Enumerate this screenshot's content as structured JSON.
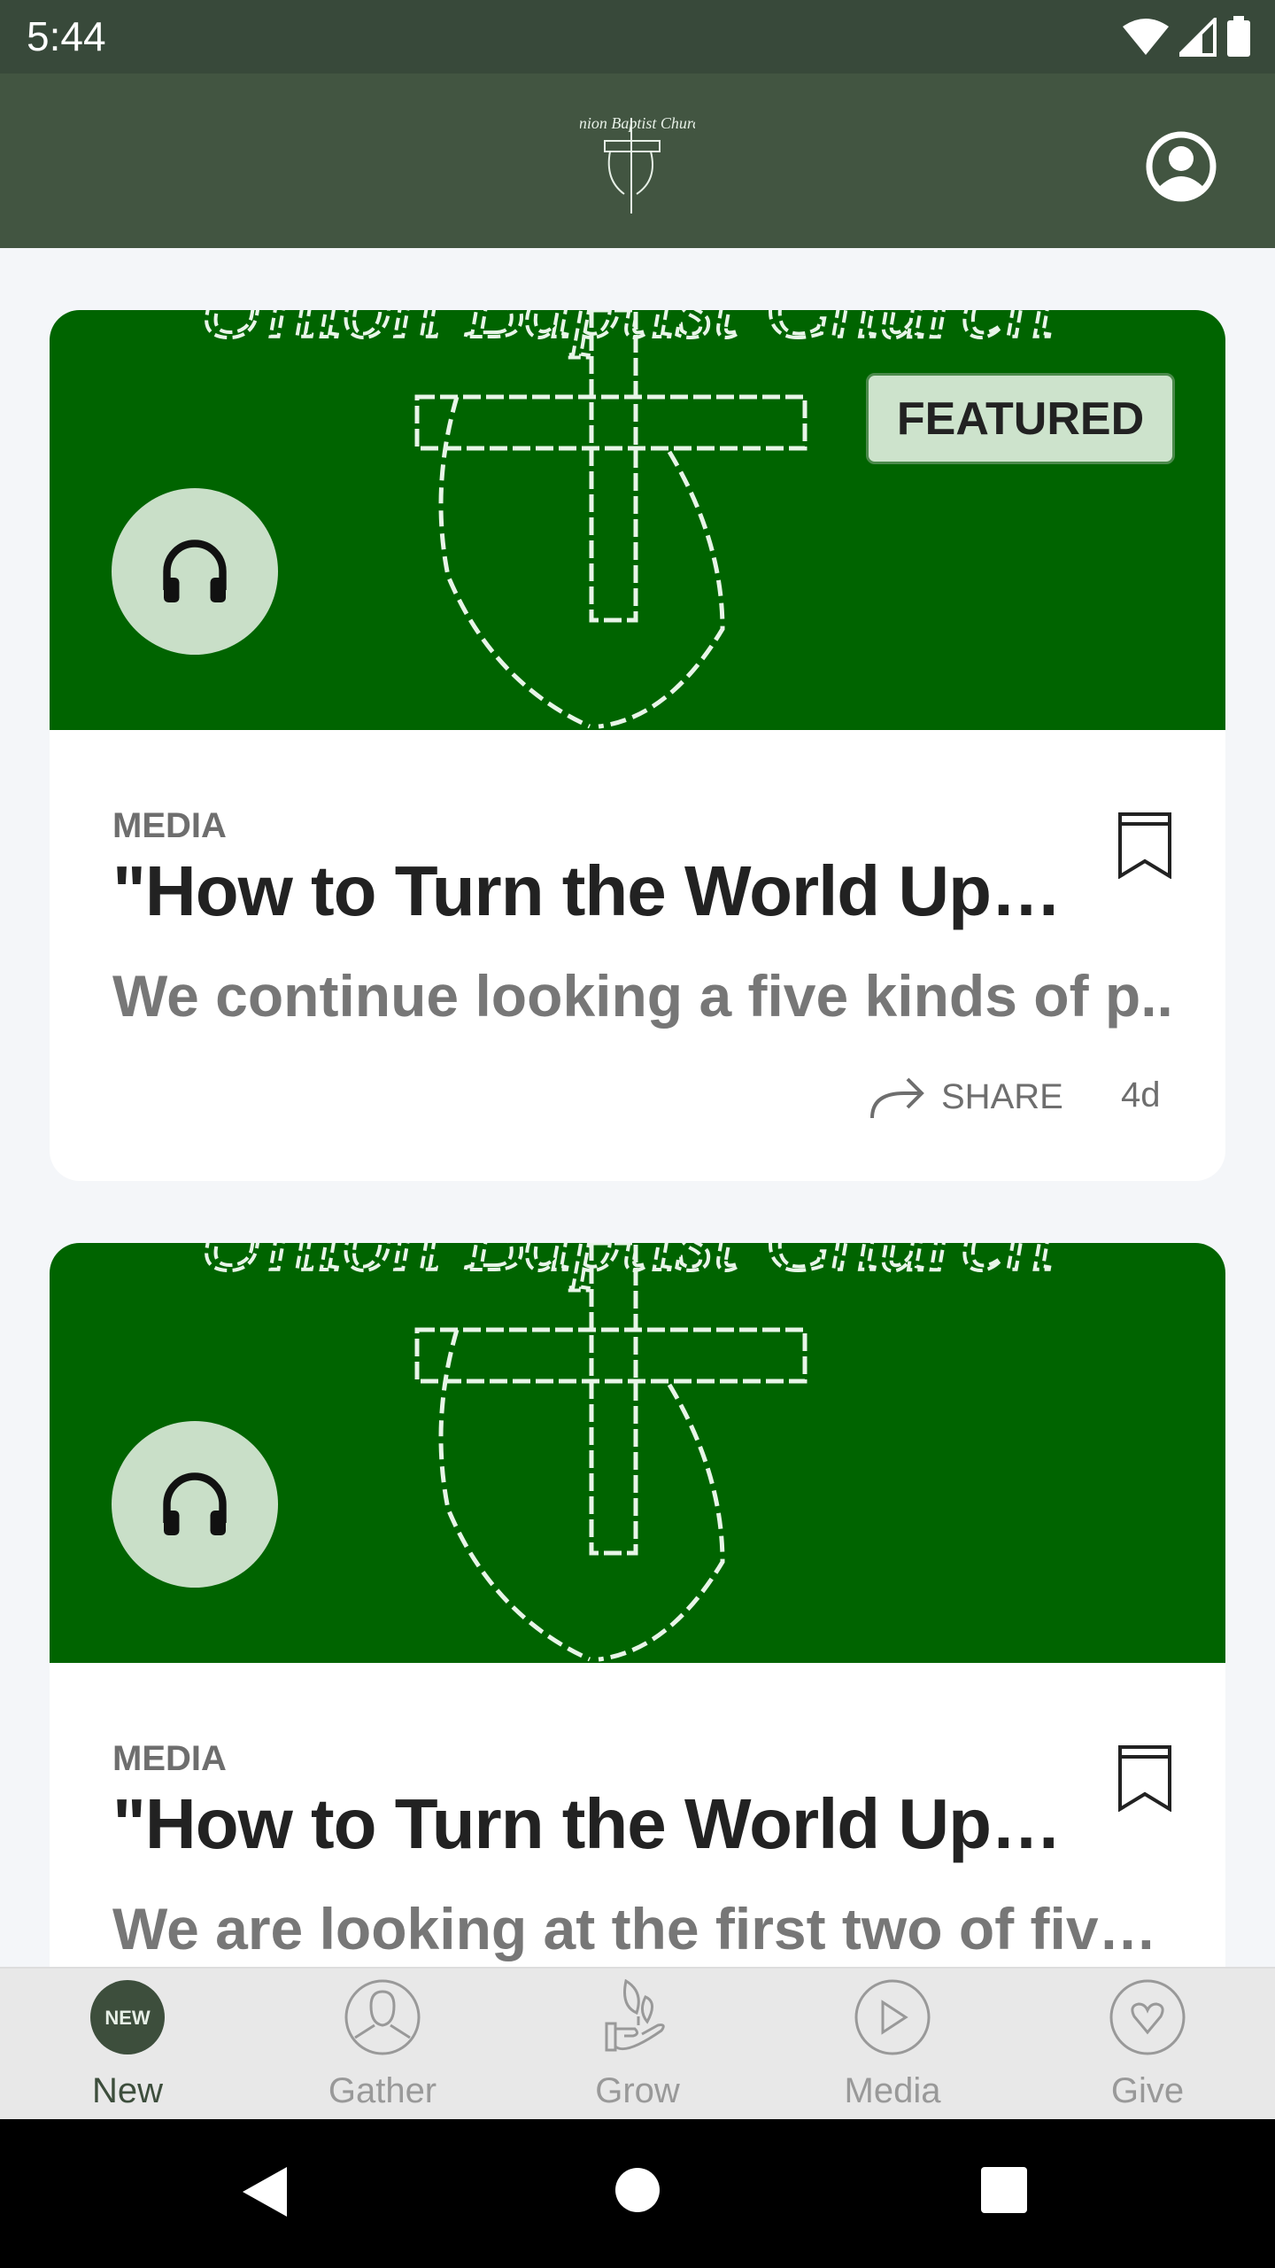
{
  "status_bar": {
    "time": "5:44"
  },
  "app_bar": {
    "logo_text": "Union Baptist Church",
    "profile_icon": "account-circle-icon"
  },
  "colors": {
    "header": "#425541",
    "card_image": "#006400",
    "badge": "#cde3cc",
    "accent": "#3d4e3c"
  },
  "feed": [
    {
      "featured_label": "FEATURED",
      "category": "MEDIA",
      "title": "\"How to Turn the World Up…",
      "subtitle": "We continue looking a five kinds of p..",
      "share_label": "SHARE",
      "age": "4d",
      "icon": "headphones-icon"
    },
    {
      "category": "MEDIA",
      "title": "\"How to Turn the World Up…",
      "subtitle": "We are looking at the first two of fiv…",
      "icon": "headphones-icon"
    }
  ],
  "tabs": [
    {
      "label": "New",
      "badge": "NEW",
      "active": true
    },
    {
      "label": "Gather"
    },
    {
      "label": "Grow"
    },
    {
      "label": "Media"
    },
    {
      "label": "Give"
    }
  ]
}
